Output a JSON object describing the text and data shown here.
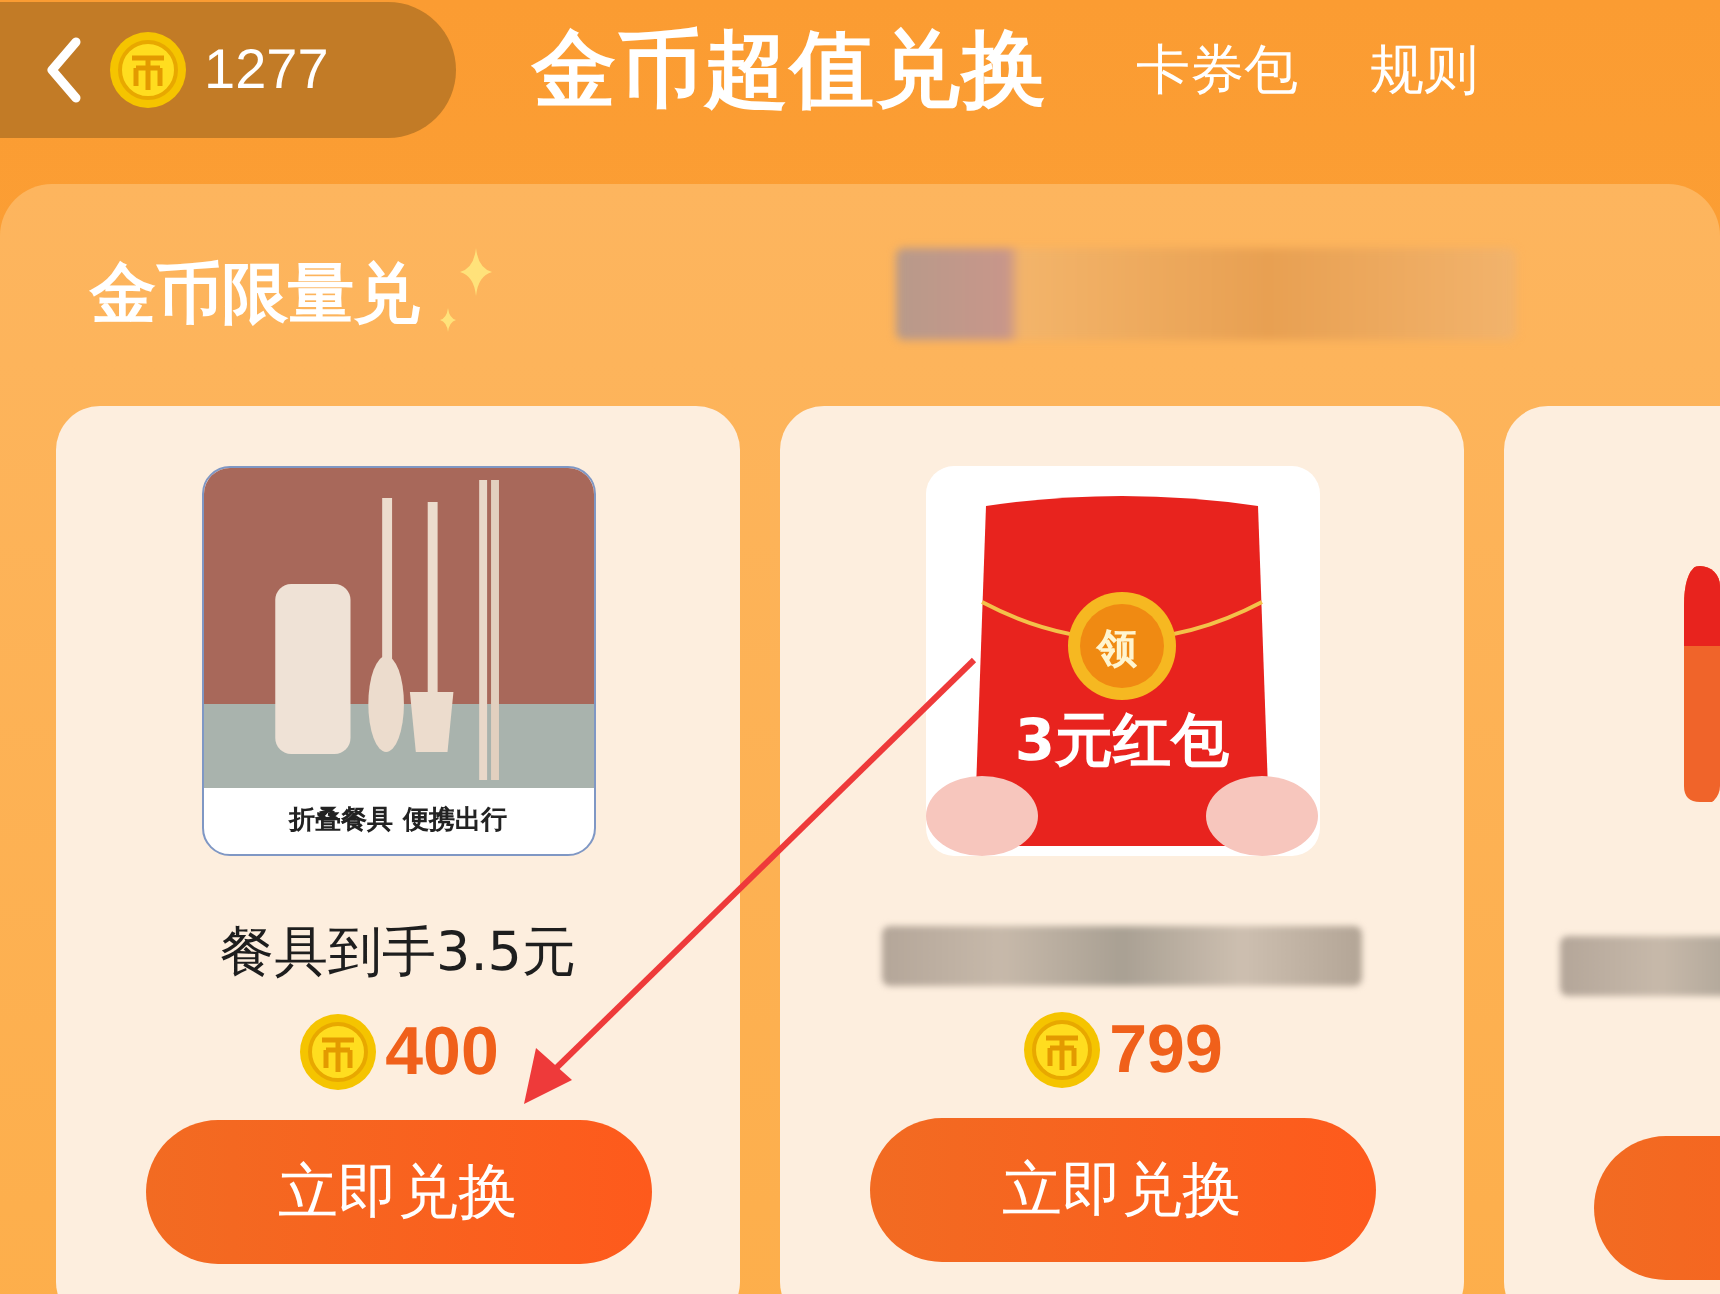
{
  "header": {
    "coin_balance": "1277",
    "title": "金币超值兑换",
    "links": [
      "卡券包",
      "规则"
    ]
  },
  "section": {
    "title": "金币限量兑"
  },
  "products": [
    {
      "caption": "折叠餐具 便携出行",
      "name": "餐具到手3.5元",
      "price": "400",
      "button": "立即兑换"
    },
    {
      "kind": "red-packet",
      "badge": "领",
      "packet_text": "3元红包",
      "price": "799",
      "button": "立即兑换"
    },
    {
      "kind": "partial"
    }
  ]
}
